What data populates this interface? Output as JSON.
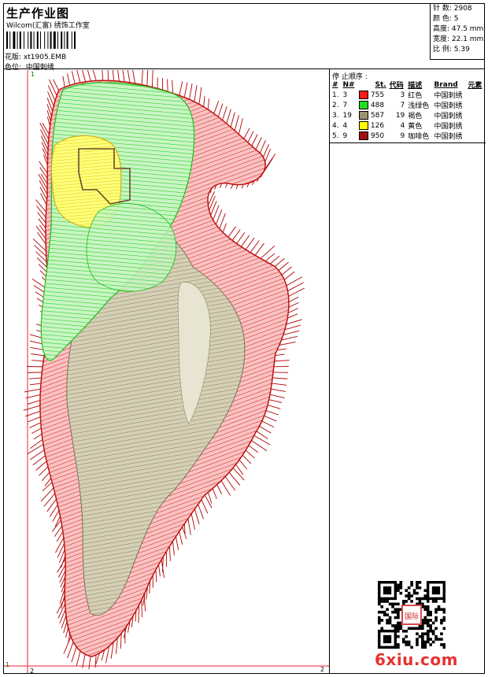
{
  "header": {
    "title": "生产作业图",
    "company": "Wilcom(汇富) 绣饰工作室",
    "file_label": "花版:",
    "file_name": "xt1905.EMB",
    "color_label": "色位:",
    "color_value": "中国刺绣"
  },
  "stats": {
    "stitches": "针 数: 2908",
    "colors": "颜 色: 5",
    "height": "高度: 47.5 mm",
    "width": "宽度: 22.1 mm",
    "ratio": "比 例: 5.39"
  },
  "stop_sequence": {
    "title": "停 止顺序 :",
    "headers": [
      "#",
      "N#",
      "St.",
      "代码",
      "描述",
      "Brand",
      "元素"
    ],
    "rows": [
      {
        "idx": "1.",
        "num": "3",
        "color": "#ff1a1a",
        "st": "755",
        "code": "3",
        "desc": "红色",
        "brand": "中国刺绣"
      },
      {
        "idx": "2.",
        "num": "7",
        "color": "#22dd22",
        "st": "488",
        "code": "7",
        "desc": "浅绿色",
        "brand": "中国刺绣"
      },
      {
        "idx": "3.",
        "num": "19",
        "color": "#9c9272",
        "st": "587",
        "code": "19",
        "desc": "褐色",
        "brand": "中国刺绣"
      },
      {
        "idx": "4.",
        "num": "4",
        "color": "#ffff00",
        "st": "126",
        "code": "4",
        "desc": "黄色",
        "brand": "中国刺绣"
      },
      {
        "idx": "5.",
        "num": "9",
        "color": "#a01010",
        "st": "950",
        "code": "9",
        "desc": "咖啡色",
        "brand": "中国刺绣"
      }
    ]
  },
  "canvas": {
    "marker_top": "1",
    "marker_bottom_left": "2",
    "marker_bottom_right": "2",
    "marker_left": "1"
  },
  "watermark": "6xiu.com",
  "stamp": "国际"
}
